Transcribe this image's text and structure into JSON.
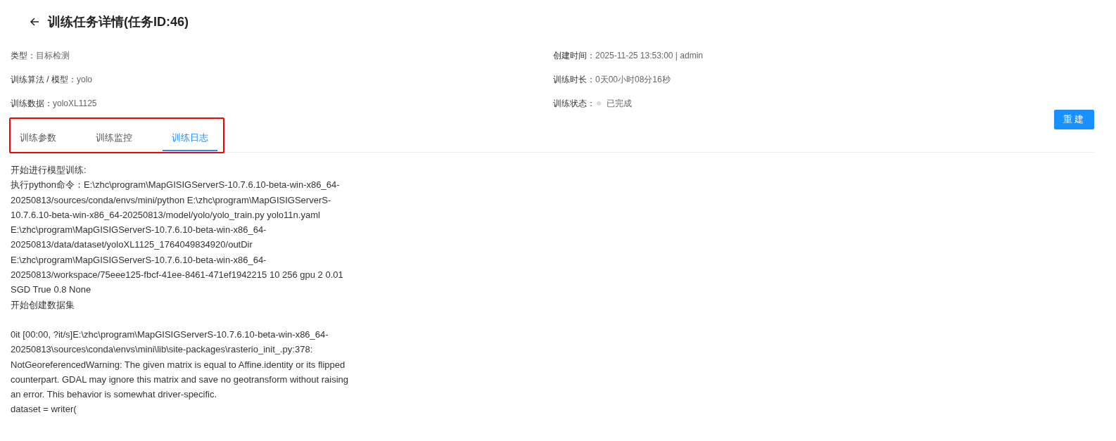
{
  "header": {
    "title": "训练任务详情(任务ID:46)"
  },
  "info_left": [
    {
      "label": "类型：",
      "value": "目标检测"
    },
    {
      "label": "训练算法 / 模型：",
      "value": "yolo"
    },
    {
      "label": "训练数据：",
      "value": "yoloXL1125"
    }
  ],
  "info_right": [
    {
      "label": "创建时间：",
      "value": "2025-11-25 13:53:00 | admin"
    },
    {
      "label": "训练时长：",
      "value": "0天00小时08分16秒"
    },
    {
      "label": "训练状态：",
      "value": "已完成",
      "color": "#d9d9d9"
    }
  ],
  "rebuild_button": "重建",
  "tabs": [
    {
      "label": "训练参数",
      "selected": false
    },
    {
      "label": "训练监控",
      "selected": false
    },
    {
      "label": "训练日志",
      "selected": true
    }
  ],
  "tabs_highlighted": true,
  "log": [
    {
      "lines": [
        "开始进行模型训练:",
        "执行python命令：E:\\zhc\\program\\MapGISIGServerS-10.7.6.10-beta-win-x86_64-",
        "20250813/sources/conda/envs/mini/python E:\\zhc\\program\\MapGISIGServerS-",
        "10.7.6.10-beta-win-x86_64-20250813/model/yolo/yolo_train.py yolo11n.yaml",
        "E:\\zhc\\program\\MapGISIGServerS-10.7.6.10-beta-win-x86_64-",
        "20250813/data/dataset/yoloXL1125_1764049834920/outDir",
        "E:\\zhc\\program\\MapGISIGServerS-10.7.6.10-beta-win-x86_64-",
        "20250813/workspace/75eee125-fbcf-41ee-8461-471ef1942215 10 256 gpu 2 0.01",
        "SGD True 0.8 None",
        "开始创建数据集"
      ]
    },
    {
      "lines": [
        "0it [00:00, ?it/s]E:\\zhc\\program\\MapGISIGServerS-10.7.6.10-beta-win-x86_64-",
        "20250813\\sources\\conda\\envs\\mini\\lib\\site-packages\\rasterio_init_.py:378:",
        "NotGeoreferencedWarning: The given matrix is equal to Affine.identity or its flipped",
        "counterpart. GDAL may ignore this matrix and save no geotransform without raising",
        "an error. This behavior is somewhat driver-specific.",
        "dataset = writer("
      ]
    }
  ]
}
